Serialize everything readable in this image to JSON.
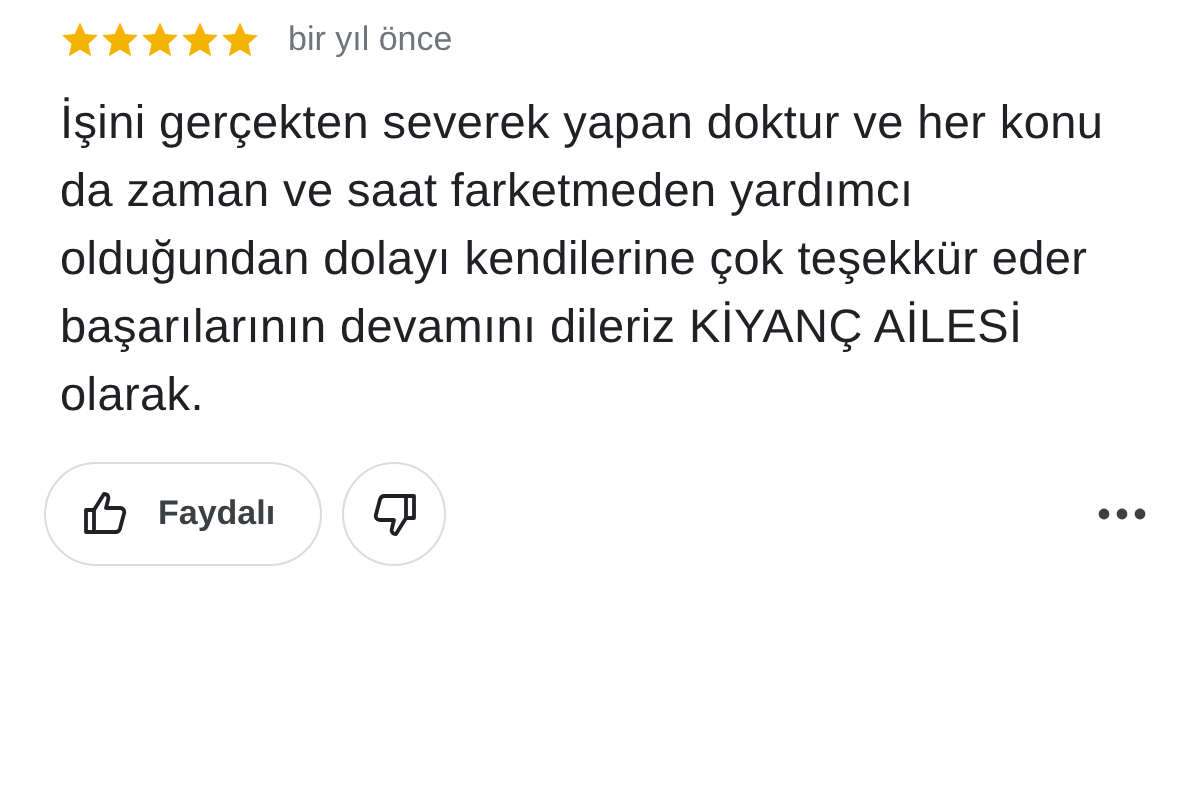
{
  "review": {
    "stars": 5,
    "time": "bir yıl önce",
    "text": "İşini gerçekten severek yapan doktur ve her konu da zaman ve saat farketmeden yardımcı olduğundan dolayı kendilerine çok teşekkür eder başarılarının devamını dileriz KİYANÇ AİLESİ olarak."
  },
  "actions": {
    "helpful_label": "Faydalı"
  }
}
